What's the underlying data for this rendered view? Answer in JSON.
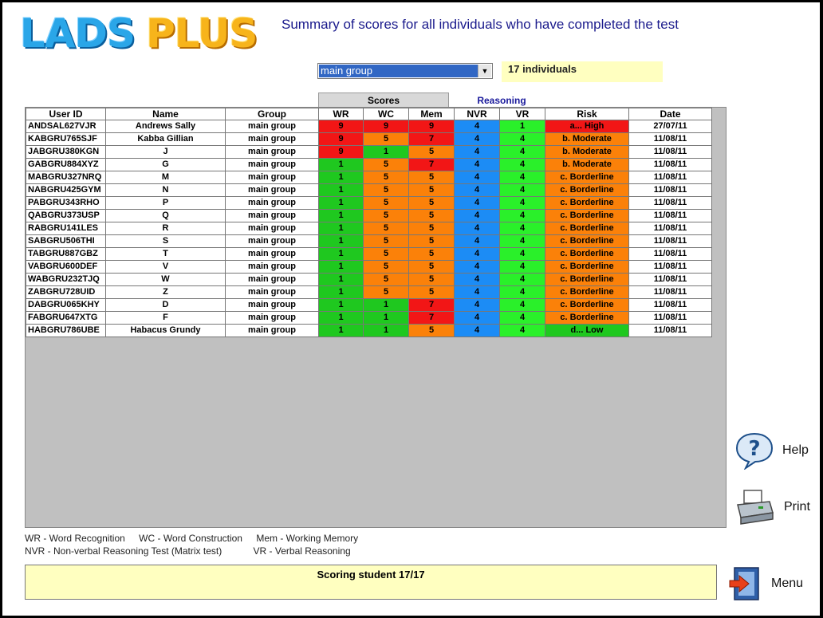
{
  "app": {
    "logo_left": "LADS",
    "logo_right": "PLUS",
    "title": "Summary of scores for all individuals who have completed the test"
  },
  "filter": {
    "selected": "main group",
    "count_label": "17  individuals"
  },
  "tabs": {
    "scores": "Scores",
    "reasoning": "Reasoning"
  },
  "table": {
    "headers": [
      "User ID",
      "Name",
      "Group",
      "WR",
      "WC",
      "Mem",
      "NVR",
      "VR",
      "Risk",
      "Date"
    ],
    "rows": [
      {
        "id": "ANDSAL627VJR",
        "name": "Andrews Sally",
        "group": "main group",
        "wr": "9",
        "wc": "9",
        "mem": "9",
        "nvr": "4",
        "vr": "1",
        "risk": "a... High",
        "date": "27/07/11",
        "wr_c": "red",
        "wc_c": "red",
        "mem_c": "red",
        "vr_c": "lgreen",
        "risk_c": "r-high"
      },
      {
        "id": "KABGRU765SJF",
        "name": "Kabba Gillian",
        "group": "main group",
        "wr": "9",
        "wc": "5",
        "mem": "7",
        "nvr": "4",
        "vr": "4",
        "risk": "b. Moderate",
        "date": "11/08/11",
        "wr_c": "red",
        "wc_c": "orange",
        "mem_c": "red",
        "vr_c": "lgreen",
        "risk_c": "r-mod"
      },
      {
        "id": "JABGRU380KGN",
        "name": "J",
        "group": "main group",
        "wr": "9",
        "wc": "1",
        "mem": "5",
        "nvr": "4",
        "vr": "4",
        "risk": "b. Moderate",
        "date": "11/08/11",
        "wr_c": "red",
        "wc_c": "green",
        "mem_c": "orange",
        "vr_c": "lgreen",
        "risk_c": "r-mod"
      },
      {
        "id": "GABGRU884XYZ",
        "name": "G",
        "group": "main group",
        "wr": "1",
        "wc": "5",
        "mem": "7",
        "nvr": "4",
        "vr": "4",
        "risk": "b. Moderate",
        "date": "11/08/11",
        "wr_c": "green",
        "wc_c": "orange",
        "mem_c": "red",
        "vr_c": "lgreen",
        "risk_c": "r-mod"
      },
      {
        "id": "MABGRU327NRQ",
        "name": "M",
        "group": "main group",
        "wr": "1",
        "wc": "5",
        "mem": "5",
        "nvr": "4",
        "vr": "4",
        "risk": "c. Borderline",
        "date": "11/08/11",
        "wr_c": "green",
        "wc_c": "orange",
        "mem_c": "orange",
        "vr_c": "lgreen",
        "risk_c": "r-border"
      },
      {
        "id": "NABGRU425GYM",
        "name": "N",
        "group": "main group",
        "wr": "1",
        "wc": "5",
        "mem": "5",
        "nvr": "4",
        "vr": "4",
        "risk": "c. Borderline",
        "date": "11/08/11",
        "wr_c": "green",
        "wc_c": "orange",
        "mem_c": "orange",
        "vr_c": "lgreen",
        "risk_c": "r-border"
      },
      {
        "id": "PABGRU343RHO",
        "name": "P",
        "group": "main group",
        "wr": "1",
        "wc": "5",
        "mem": "5",
        "nvr": "4",
        "vr": "4",
        "risk": "c. Borderline",
        "date": "11/08/11",
        "wr_c": "green",
        "wc_c": "orange",
        "mem_c": "orange",
        "vr_c": "lgreen",
        "risk_c": "r-border"
      },
      {
        "id": "QABGRU373USP",
        "name": "Q",
        "group": "main group",
        "wr": "1",
        "wc": "5",
        "mem": "5",
        "nvr": "4",
        "vr": "4",
        "risk": "c. Borderline",
        "date": "11/08/11",
        "wr_c": "green",
        "wc_c": "orange",
        "mem_c": "orange",
        "vr_c": "lgreen",
        "risk_c": "r-border"
      },
      {
        "id": "RABGRU141LES",
        "name": "R",
        "group": "main group",
        "wr": "1",
        "wc": "5",
        "mem": "5",
        "nvr": "4",
        "vr": "4",
        "risk": "c. Borderline",
        "date": "11/08/11",
        "wr_c": "green",
        "wc_c": "orange",
        "mem_c": "orange",
        "vr_c": "lgreen",
        "risk_c": "r-border"
      },
      {
        "id": "SABGRU506THI",
        "name": "S",
        "group": "main group",
        "wr": "1",
        "wc": "5",
        "mem": "5",
        "nvr": "4",
        "vr": "4",
        "risk": "c. Borderline",
        "date": "11/08/11",
        "wr_c": "green",
        "wc_c": "orange",
        "mem_c": "orange",
        "vr_c": "lgreen",
        "risk_c": "r-border"
      },
      {
        "id": "TABGRU887GBZ",
        "name": "T",
        "group": "main group",
        "wr": "1",
        "wc": "5",
        "mem": "5",
        "nvr": "4",
        "vr": "4",
        "risk": "c. Borderline",
        "date": "11/08/11",
        "wr_c": "green",
        "wc_c": "orange",
        "mem_c": "orange",
        "vr_c": "lgreen",
        "risk_c": "r-border"
      },
      {
        "id": "VABGRU600DEF",
        "name": "V",
        "group": "main group",
        "wr": "1",
        "wc": "5",
        "mem": "5",
        "nvr": "4",
        "vr": "4",
        "risk": "c. Borderline",
        "date": "11/08/11",
        "wr_c": "green",
        "wc_c": "orange",
        "mem_c": "orange",
        "vr_c": "lgreen",
        "risk_c": "r-border"
      },
      {
        "id": "WABGRU232TJQ",
        "name": "W",
        "group": "main group",
        "wr": "1",
        "wc": "5",
        "mem": "5",
        "nvr": "4",
        "vr": "4",
        "risk": "c. Borderline",
        "date": "11/08/11",
        "wr_c": "green",
        "wc_c": "orange",
        "mem_c": "orange",
        "vr_c": "lgreen",
        "risk_c": "r-border"
      },
      {
        "id": "ZABGRU728UID",
        "name": "Z",
        "group": "main group",
        "wr": "1",
        "wc": "5",
        "mem": "5",
        "nvr": "4",
        "vr": "4",
        "risk": "c. Borderline",
        "date": "11/08/11",
        "wr_c": "green",
        "wc_c": "orange",
        "mem_c": "orange",
        "vr_c": "lgreen",
        "risk_c": "r-border"
      },
      {
        "id": "DABGRU065KHY",
        "name": "D",
        "group": "main group",
        "wr": "1",
        "wc": "1",
        "mem": "7",
        "nvr": "4",
        "vr": "4",
        "risk": "c. Borderline",
        "date": "11/08/11",
        "wr_c": "green",
        "wc_c": "green",
        "mem_c": "red",
        "vr_c": "lgreen",
        "risk_c": "r-border"
      },
      {
        "id": "FABGRU647XTG",
        "name": "F",
        "group": "main group",
        "wr": "1",
        "wc": "1",
        "mem": "7",
        "nvr": "4",
        "vr": "4",
        "risk": "c. Borderline",
        "date": "11/08/11",
        "wr_c": "green",
        "wc_c": "green",
        "mem_c": "red",
        "vr_c": "lgreen",
        "risk_c": "r-border"
      },
      {
        "id": "HABGRU786UBE",
        "name": "Habacus Grundy",
        "group": "main group",
        "wr": "1",
        "wc": "1",
        "mem": "5",
        "nvr": "4",
        "vr": "4",
        "risk": "d... Low",
        "date": "11/08/11",
        "wr_c": "green",
        "wc_c": "green",
        "mem_c": "orange",
        "vr_c": "lgreen",
        "risk_c": "r-low"
      }
    ]
  },
  "legend": {
    "line1": [
      "WR - Word Recognition",
      "WC - Word Construction",
      "Mem - Working Memory"
    ],
    "line2": [
      "NVR - Non-verbal Reasoning Test (Matrix test)",
      "VR - Verbal Reasoning"
    ]
  },
  "status": {
    "text": "Scoring student 17/17"
  },
  "side": {
    "help": "Help",
    "print": "Print",
    "menu": "Menu"
  },
  "icons": {
    "help": "help-icon",
    "print": "printer-icon",
    "menu": "exit-door-icon",
    "dropdown": "chevron-down-icon"
  }
}
